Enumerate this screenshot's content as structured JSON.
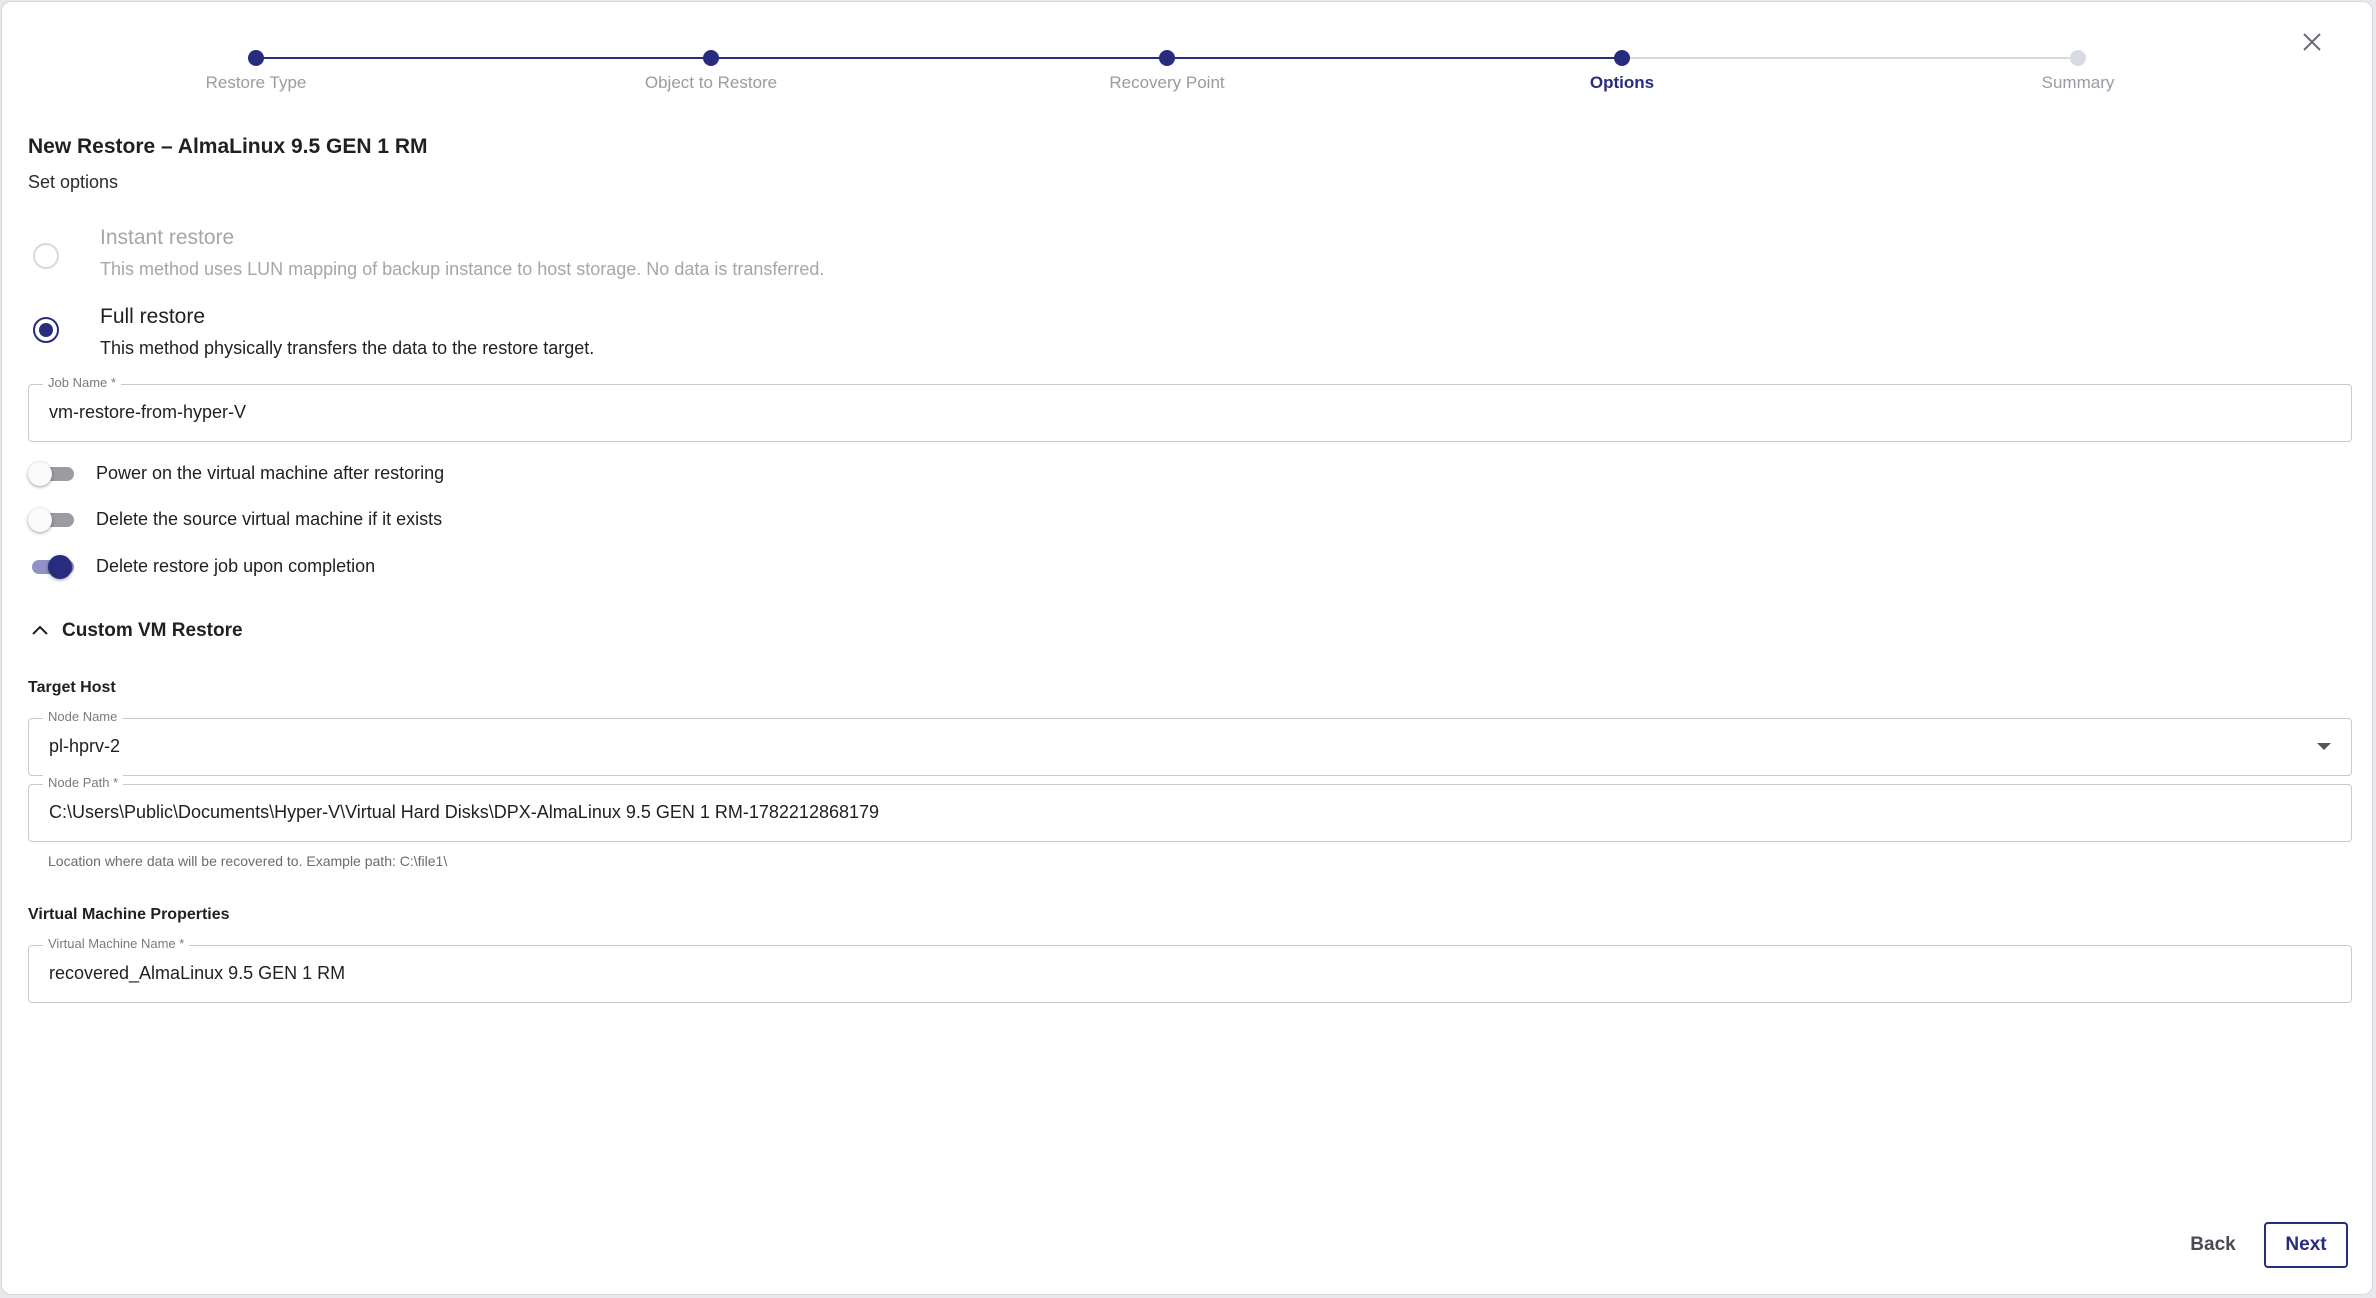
{
  "colors": {
    "accent": "#282c7f",
    "inactive_step": "#d8dae2"
  },
  "stepper": {
    "steps": [
      {
        "label": "Restore Type",
        "state": "done"
      },
      {
        "label": "Object to Restore",
        "state": "done"
      },
      {
        "label": "Recovery Point",
        "state": "done"
      },
      {
        "label": "Options",
        "state": "active"
      },
      {
        "label": "Summary",
        "state": "pending"
      }
    ]
  },
  "header": {
    "title": "New Restore – AlmaLinux 9.5 GEN 1 RM",
    "subtitle": "Set options"
  },
  "restore_method": {
    "instant": {
      "label": "Instant restore",
      "description": "This method uses LUN mapping of backup instance to host storage. No data is transferred.",
      "enabled": false,
      "selected": false
    },
    "full": {
      "label": "Full restore",
      "description": "This method physically transfers the data to the restore target.",
      "enabled": true,
      "selected": true
    }
  },
  "job_name": {
    "label": "Job Name *",
    "value": "vm-restore-from-hyper-V"
  },
  "toggles": [
    {
      "label": "Power on the virtual machine after restoring",
      "on": false
    },
    {
      "label": "Delete the source virtual machine if it exists",
      "on": false
    },
    {
      "label": "Delete restore job upon completion",
      "on": true
    }
  ],
  "custom_restore": {
    "label": "Custom VM Restore",
    "expanded": true,
    "target_host": {
      "heading": "Target Host",
      "node_name": {
        "label": "Node Name",
        "value": "pl-hprv-2"
      },
      "node_path": {
        "label": "Node Path *",
        "value": "C:\\Users\\Public\\Documents\\Hyper-V\\Virtual Hard Disks\\DPX-AlmaLinux 9.5 GEN 1 RM-1782212868179",
        "helper": "Location where data will be recovered to. Example path: C:\\file1\\"
      }
    },
    "vm_properties": {
      "heading": "Virtual Machine Properties",
      "vm_name": {
        "label": "Virtual Machine Name *",
        "value": "recovered_AlmaLinux 9.5 GEN 1 RM"
      }
    }
  },
  "footer": {
    "back_label": "Back",
    "next_label": "Next"
  }
}
